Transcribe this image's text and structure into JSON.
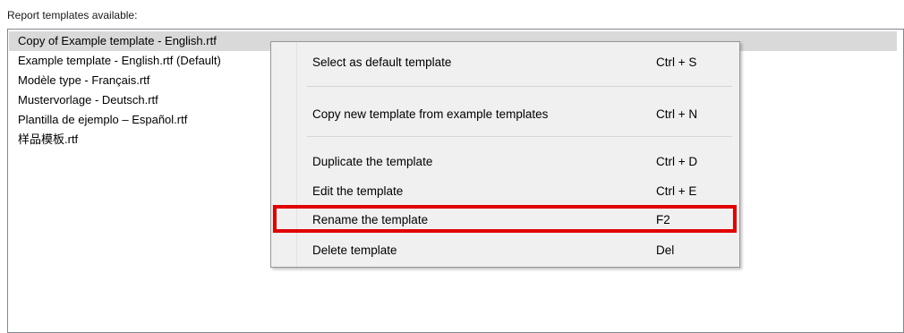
{
  "heading": "Report templates available:",
  "templates": [
    "Copy of Example template - English.rtf",
    "Example template - English.rtf (Default)",
    "Modèle type - Français.rtf",
    "Mustervorlage - Deutsch.rtf",
    "Plantilla de ejemplo – Español.rtf",
    "样品模板.rtf"
  ],
  "selected_index": 0,
  "context_menu": {
    "items": [
      {
        "label": "Select as default template",
        "shortcut": "Ctrl + S"
      },
      {
        "label": "Copy new template from example templates",
        "shortcut": "Ctrl + N"
      },
      {
        "label": "Duplicate the template",
        "shortcut": "Ctrl + D"
      },
      {
        "label": "Edit the template",
        "shortcut": "Ctrl + E"
      },
      {
        "label": "Rename the template",
        "shortcut": "F2"
      },
      {
        "label": "Delete template",
        "shortcut": "Del"
      }
    ],
    "highlighted_index": 4
  },
  "colors": {
    "selection": "#d9d9d9",
    "menu_background": "#f0f0f0",
    "highlight_border": "#e10000"
  }
}
